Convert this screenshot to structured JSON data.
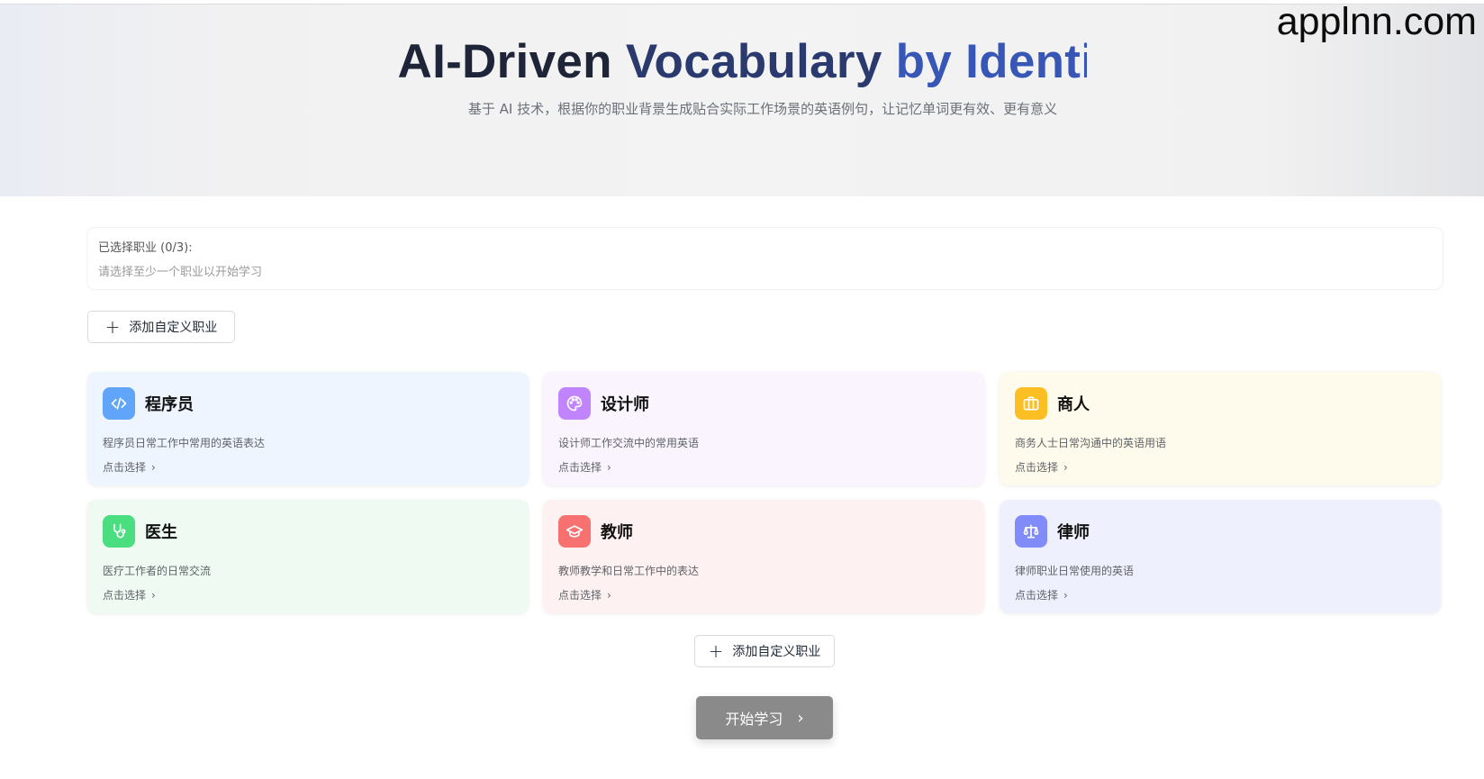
{
  "hero": {
    "title_part1": "AI-Driven ",
    "title_part2": "Vocabulary ",
    "title_part3": "by Identit",
    "subtitle": "基于 AI 技术，根据你的职业背景生成贴合实际工作场景的英语例句，让记忆单词更有效、更有意义"
  },
  "watermark": "applnn.com",
  "selection": {
    "label": "已选择职业 (0/3):",
    "hint": "请选择至少一个职业以开始学习"
  },
  "add_custom_label": "添加自定义职业",
  "cards": [
    {
      "title": "程序员",
      "desc": "程序员日常工作中常用的英语表达",
      "action": "点击选择",
      "icon": "code-icon",
      "icon_color": "#60a5fa",
      "bg": "#eff5fe"
    },
    {
      "title": "设计师",
      "desc": "设计师工作交流中的常用英语",
      "action": "点击选择",
      "icon": "palette-icon",
      "icon_color": "#c084fc",
      "bg": "#f9f4fe"
    },
    {
      "title": "商人",
      "desc": "商务人士日常沟通中的英语用语",
      "action": "点击选择",
      "icon": "briefcase-icon",
      "icon_color": "#fbbf24",
      "bg": "#fefbec"
    },
    {
      "title": "医生",
      "desc": "医疗工作者的日常交流",
      "action": "点击选择",
      "icon": "stethoscope-icon",
      "icon_color": "#4ade80",
      "bg": "#effbf2"
    },
    {
      "title": "教师",
      "desc": "教师教学和日常工作中的表达",
      "action": "点击选择",
      "icon": "graduation-cap-icon",
      "icon_color": "#f87171",
      "bg": "#fef1f1"
    },
    {
      "title": "律师",
      "desc": "律师职业日常使用的英语",
      "action": "点击选择",
      "icon": "scales-icon",
      "icon_color": "#818cf8",
      "bg": "#eef1fd"
    }
  ],
  "start_button": "开始学习"
}
